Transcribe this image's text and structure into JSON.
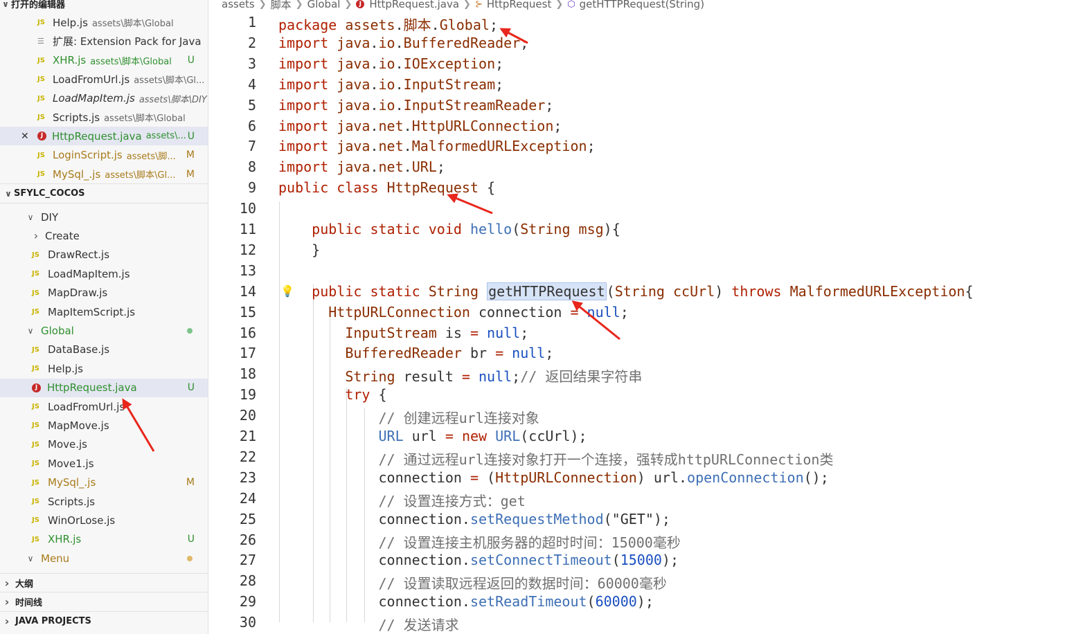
{
  "sidebar": {
    "open_editors": {
      "title": "打开的编辑器",
      "items": [
        {
          "name": "Help.js",
          "path": "assets\\脚本\\Global",
          "status": "",
          "style": "normal"
        },
        {
          "name": "扩展: Extension Pack for Java",
          "path": "",
          "status": "",
          "style": "ext"
        },
        {
          "name": "XHR.js",
          "path": "assets\\脚本\\Global",
          "status": "U",
          "style": "green"
        },
        {
          "name": "LoadFromUrl.js",
          "path": "assets\\脚本\\Gl...",
          "status": "",
          "style": "normal"
        },
        {
          "name": "LoadMapItem.js",
          "path": "assets\\脚本\\DIY",
          "status": "",
          "style": "italic"
        },
        {
          "name": "Scripts.js",
          "path": "assets\\脚本\\Global",
          "status": "",
          "style": "normal"
        },
        {
          "name": "HttpRequest.java",
          "path": "assets\\...",
          "status": "U",
          "style": "java-active"
        },
        {
          "name": "LoginScript.js",
          "path": "assets\\脚...",
          "status": "M",
          "style": "orange"
        },
        {
          "name": "MySql_.js",
          "path": "assets\\脚本\\Gl...",
          "status": "M",
          "style": "orange"
        }
      ]
    },
    "project": {
      "title": "SFYLC_COCOS",
      "tree": [
        {
          "label": "DIY",
          "type": "folder-open",
          "depth": 1,
          "status": ""
        },
        {
          "label": "Create",
          "type": "folder-closed",
          "depth": 2,
          "status": ""
        },
        {
          "label": "DrawRect.js",
          "type": "js",
          "depth": 2,
          "status": ""
        },
        {
          "label": "LoadMapItem.js",
          "type": "js",
          "depth": 2,
          "status": ""
        },
        {
          "label": "MapDraw.js",
          "type": "js",
          "depth": 2,
          "status": ""
        },
        {
          "label": "MapItemScript.js",
          "type": "js",
          "depth": 2,
          "status": ""
        },
        {
          "label": "Global",
          "type": "folder-open-green",
          "depth": 1,
          "status": "dot-green"
        },
        {
          "label": "DataBase.js",
          "type": "js",
          "depth": 2,
          "status": ""
        },
        {
          "label": "Help.js",
          "type": "js",
          "depth": 2,
          "status": ""
        },
        {
          "label": "HttpRequest.java",
          "type": "java",
          "depth": 2,
          "status": "U"
        },
        {
          "label": "LoadFromUrl.js",
          "type": "js",
          "depth": 2,
          "status": ""
        },
        {
          "label": "MapMove.js",
          "type": "js",
          "depth": 2,
          "status": ""
        },
        {
          "label": "Move.js",
          "type": "js",
          "depth": 2,
          "status": ""
        },
        {
          "label": "Move1.js",
          "type": "js",
          "depth": 2,
          "status": ""
        },
        {
          "label": "MySql_.js",
          "type": "js-orange",
          "depth": 2,
          "status": "M"
        },
        {
          "label": "Scripts.js",
          "type": "js",
          "depth": 2,
          "status": ""
        },
        {
          "label": "WinOrLose.js",
          "type": "js",
          "depth": 2,
          "status": ""
        },
        {
          "label": "XHR.js",
          "type": "js-green",
          "depth": 2,
          "status": "U"
        },
        {
          "label": "Menu",
          "type": "folder-open-orange",
          "depth": 1,
          "status": "dot-orange"
        }
      ]
    },
    "bottom_sections": [
      "大纲",
      "时间线",
      "JAVA PROJECTS"
    ]
  },
  "breadcrumb": [
    "assets",
    "脚本",
    "Global",
    "HttpRequest.java",
    "HttpRequest",
    "getHTTPRequest(String)"
  ],
  "editor": {
    "lines": [
      [
        [
          "kw",
          "package"
        ],
        [
          "t",
          " "
        ],
        [
          "tp",
          "assets"
        ],
        [
          "t",
          "."
        ],
        [
          "tp",
          "脚本"
        ],
        [
          "t",
          "."
        ],
        [
          "tp",
          "Global"
        ],
        [
          "t",
          ";"
        ]
      ],
      [
        [
          "kw",
          "import"
        ],
        [
          "t",
          " "
        ],
        [
          "tp",
          "java"
        ],
        [
          "t",
          "."
        ],
        [
          "tp",
          "io"
        ],
        [
          "t",
          "."
        ],
        [
          "tp",
          "BufferedReader"
        ],
        [
          "t",
          ";"
        ]
      ],
      [
        [
          "kw",
          "import"
        ],
        [
          "t",
          " "
        ],
        [
          "tp",
          "java"
        ],
        [
          "t",
          "."
        ],
        [
          "tp",
          "io"
        ],
        [
          "t",
          "."
        ],
        [
          "tp",
          "IOException"
        ],
        [
          "t",
          ";"
        ]
      ],
      [
        [
          "kw",
          "import"
        ],
        [
          "t",
          " "
        ],
        [
          "tp",
          "java"
        ],
        [
          "t",
          "."
        ],
        [
          "tp",
          "io"
        ],
        [
          "t",
          "."
        ],
        [
          "tp",
          "InputStream"
        ],
        [
          "t",
          ";"
        ]
      ],
      [
        [
          "kw",
          "import"
        ],
        [
          "t",
          " "
        ],
        [
          "tp",
          "java"
        ],
        [
          "t",
          "."
        ],
        [
          "tp",
          "io"
        ],
        [
          "t",
          "."
        ],
        [
          "tp",
          "InputStreamReader"
        ],
        [
          "t",
          ";"
        ]
      ],
      [
        [
          "kw",
          "import"
        ],
        [
          "t",
          " "
        ],
        [
          "tp",
          "java"
        ],
        [
          "t",
          "."
        ],
        [
          "tp",
          "net"
        ],
        [
          "t",
          "."
        ],
        [
          "tp",
          "HttpURLConnection"
        ],
        [
          "t",
          ";"
        ]
      ],
      [
        [
          "kw",
          "import"
        ],
        [
          "t",
          " "
        ],
        [
          "tp",
          "java"
        ],
        [
          "t",
          "."
        ],
        [
          "tp",
          "net"
        ],
        [
          "t",
          "."
        ],
        [
          "tp",
          "MalformedURLException"
        ],
        [
          "t",
          ";"
        ]
      ],
      [
        [
          "kw",
          "import"
        ],
        [
          "t",
          " "
        ],
        [
          "tp",
          "java"
        ],
        [
          "t",
          "."
        ],
        [
          "tp",
          "net"
        ],
        [
          "t",
          "."
        ],
        [
          "tp",
          "URL"
        ],
        [
          "t",
          ";"
        ]
      ],
      [
        [
          "kw",
          "public"
        ],
        [
          "t",
          " "
        ],
        [
          "kw",
          "class"
        ],
        [
          "t",
          " "
        ],
        [
          "tp",
          "HttpRequest"
        ],
        [
          "t",
          " {"
        ]
      ],
      [],
      [
        [
          "t",
          "    "
        ],
        [
          "kw",
          "public"
        ],
        [
          "t",
          " "
        ],
        [
          "kw",
          "static"
        ],
        [
          "t",
          " "
        ],
        [
          "kw",
          "void"
        ],
        [
          "t",
          " "
        ],
        [
          "fn",
          "hello"
        ],
        [
          "t",
          "("
        ],
        [
          "tp",
          "String"
        ],
        [
          "t",
          " "
        ],
        [
          "tp",
          "msg"
        ],
        [
          "t",
          "){"
        ]
      ],
      [
        [
          "t",
          "    }"
        ]
      ],
      [],
      [
        [
          "t",
          "    "
        ],
        [
          "kw",
          "public"
        ],
        [
          "t",
          " "
        ],
        [
          "kw",
          "static"
        ],
        [
          "t",
          " "
        ],
        [
          "tp",
          "String"
        ],
        [
          "t",
          " "
        ],
        [
          "hl",
          "getHTTPRequest"
        ],
        [
          "t",
          "("
        ],
        [
          "tp",
          "String"
        ],
        [
          "t",
          " "
        ],
        [
          "tp",
          "ccUrl"
        ],
        [
          "t",
          ") "
        ],
        [
          "kw",
          "throws"
        ],
        [
          "t",
          " "
        ],
        [
          "tp",
          "MalformedURLException"
        ],
        [
          "t",
          "{"
        ]
      ],
      [
        [
          "t",
          "      "
        ],
        [
          "tp",
          "HttpURLConnection"
        ],
        [
          "t",
          " connection "
        ],
        [
          "kw",
          "="
        ],
        [
          "t",
          " "
        ],
        [
          "nul",
          "null"
        ],
        [
          "t",
          ";"
        ]
      ],
      [
        [
          "t",
          "        "
        ],
        [
          "tp",
          "InputStream"
        ],
        [
          "t",
          " is "
        ],
        [
          "kw",
          "="
        ],
        [
          "t",
          " "
        ],
        [
          "nul",
          "null"
        ],
        [
          "t",
          ";"
        ]
      ],
      [
        [
          "t",
          "        "
        ],
        [
          "tp",
          "BufferedReader"
        ],
        [
          "t",
          " br "
        ],
        [
          "kw",
          "="
        ],
        [
          "t",
          " "
        ],
        [
          "nul",
          "null"
        ],
        [
          "t",
          ";"
        ]
      ],
      [
        [
          "t",
          "        "
        ],
        [
          "tp",
          "String"
        ],
        [
          "t",
          " result "
        ],
        [
          "kw",
          "="
        ],
        [
          "t",
          " "
        ],
        [
          "nul",
          "null"
        ],
        [
          "t",
          ";"
        ],
        [
          "cm",
          "// 返回结果字符串"
        ]
      ],
      [
        [
          "t",
          "        "
        ],
        [
          "kw",
          "try"
        ],
        [
          "t",
          " {"
        ]
      ],
      [
        [
          "t",
          "            "
        ],
        [
          "cm",
          "// 创建远程url连接对象"
        ]
      ],
      [
        [
          "t",
          "            "
        ],
        [
          "fn",
          "URL"
        ],
        [
          "t",
          " url "
        ],
        [
          "kw",
          "="
        ],
        [
          "t",
          " "
        ],
        [
          "kw",
          "new"
        ],
        [
          "t",
          " "
        ],
        [
          "fn",
          "URL"
        ],
        [
          "t",
          "(ccUrl);"
        ]
      ],
      [
        [
          "t",
          "            "
        ],
        [
          "cm",
          "// 通过远程url连接对象打开一个连接，强转成httpURLConnection类"
        ]
      ],
      [
        [
          "t",
          "            connection "
        ],
        [
          "kw",
          "="
        ],
        [
          "t",
          " ("
        ],
        [
          "tp",
          "HttpURLConnection"
        ],
        [
          "t",
          ") url."
        ],
        [
          "fn",
          "openConnection"
        ],
        [
          "t",
          "();"
        ]
      ],
      [
        [
          "t",
          "            "
        ],
        [
          "cm",
          "// 设置连接方式：get"
        ]
      ],
      [
        [
          "t",
          "            connection."
        ],
        [
          "fn",
          "setRequestMethod"
        ],
        [
          "t",
          "("
        ],
        [
          "str",
          "\"GET\""
        ],
        [
          "t",
          ");"
        ]
      ],
      [
        [
          "t",
          "            "
        ],
        [
          "cm",
          "// 设置连接主机服务器的超时时间：15000毫秒"
        ]
      ],
      [
        [
          "t",
          "            connection."
        ],
        [
          "fn",
          "setConnectTimeout"
        ],
        [
          "t",
          "("
        ],
        [
          "num",
          "15000"
        ],
        [
          "t",
          ");"
        ]
      ],
      [
        [
          "t",
          "            "
        ],
        [
          "cm",
          "// 设置读取远程返回的数据时间：60000毫秒"
        ]
      ],
      [
        [
          "t",
          "            connection."
        ],
        [
          "fn",
          "setReadTimeout"
        ],
        [
          "t",
          "("
        ],
        [
          "num",
          "60000"
        ],
        [
          "t",
          ");"
        ]
      ],
      [
        [
          "t",
          "            "
        ],
        [
          "cm",
          "// 发送请求"
        ]
      ]
    ]
  },
  "colors": {
    "annotation_arrow": "#e8261c",
    "keyword": "#af1f00",
    "function": "#3d6fb5"
  }
}
